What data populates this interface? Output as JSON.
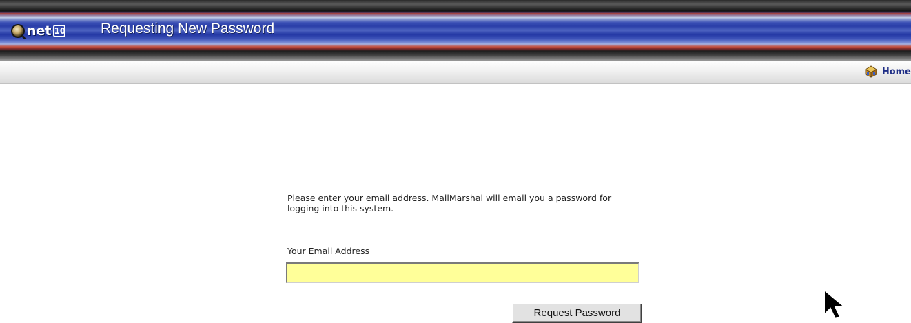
{
  "banner": {
    "logo_text": "net",
    "logo_box_text": "10",
    "title": "Requesting New Password"
  },
  "nav": {
    "home_label": "Home",
    "home_icon": "home-box-icon"
  },
  "form": {
    "instructions": "Please enter your email address. MailMarshal will email you a password for logging into this system.",
    "email_label": "Your Email Address",
    "email_value": "",
    "submit_label": "Request Password"
  },
  "colors": {
    "banner_blue": "#2a3ea8",
    "nav_link": "#1f2e86",
    "input_background": "#ffff99"
  }
}
